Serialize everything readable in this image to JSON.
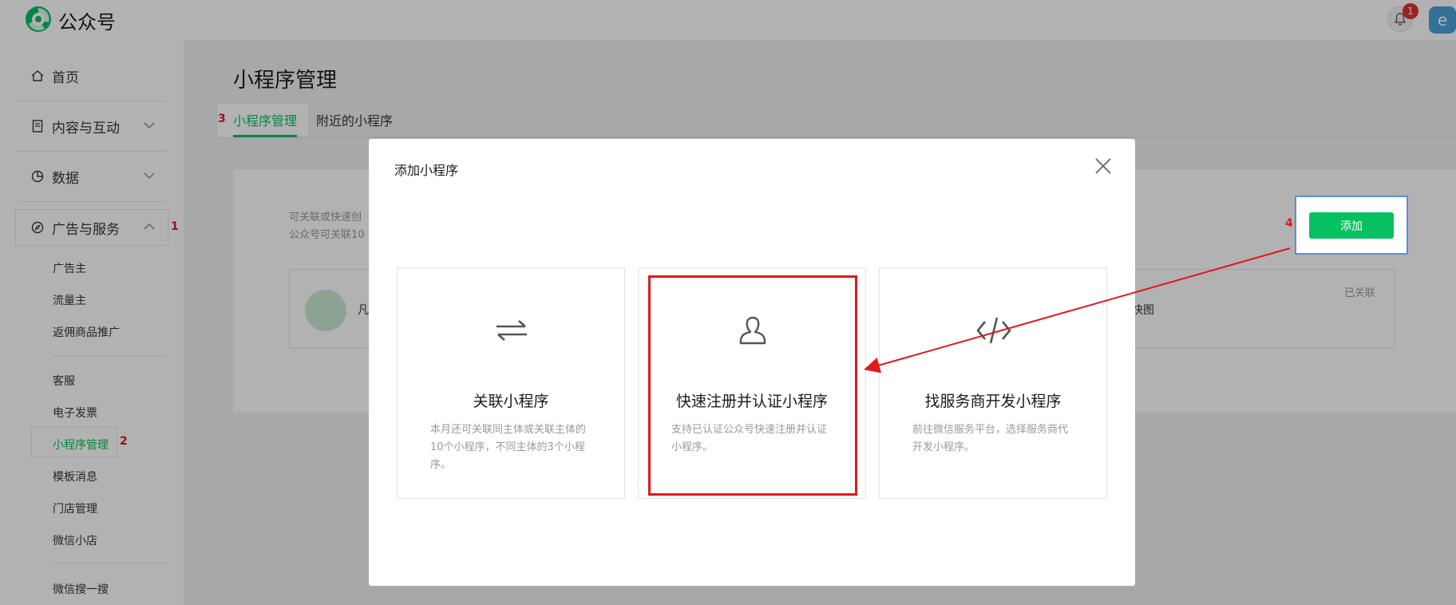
{
  "app": {
    "brand": "公众号",
    "notification_count": "1",
    "avatar_letter": "e"
  },
  "sidebar": {
    "home": "首页",
    "content": "内容与互动",
    "data": "数据",
    "ads": "广告与服务",
    "sub_ads": [
      "广告主",
      "流量主",
      "返佣商品推广"
    ],
    "sub_services": [
      "客服",
      "电子发票",
      "小程序管理",
      "模板消息",
      "门店管理",
      "微信小店"
    ],
    "search": "微信搜一搜"
  },
  "main": {
    "title": "小程序管理",
    "tabs": [
      "小程序管理",
      "附近的小程序"
    ],
    "desc_line1": "可关联或快速创",
    "desc_line2": "公众号可关联10",
    "row_left_text": "凡",
    "row_right_text": "快图",
    "linked_label": "已关联",
    "add_button": "添加"
  },
  "modal": {
    "title": "添加小程序",
    "options": [
      {
        "icon": "exchange-icon",
        "title": "关联小程序",
        "desc": "本月还可关联同主体或关联主体的10个小程序，不同主体的3个小程序。"
      },
      {
        "icon": "user-icon",
        "title": "快速注册并认证小程序",
        "desc": "支持已认证公众号快速注册并认证小程序。"
      },
      {
        "icon": "code-icon",
        "title": "找服务商开发小程序",
        "desc": "前往微信服务平台，选择服务商代开发小程序。"
      }
    ]
  },
  "annotations": {
    "m1": "1",
    "m2": "2",
    "m3": "3",
    "m4": "4",
    "color": "#e0191b"
  },
  "colors": {
    "accent": "#07c160"
  }
}
